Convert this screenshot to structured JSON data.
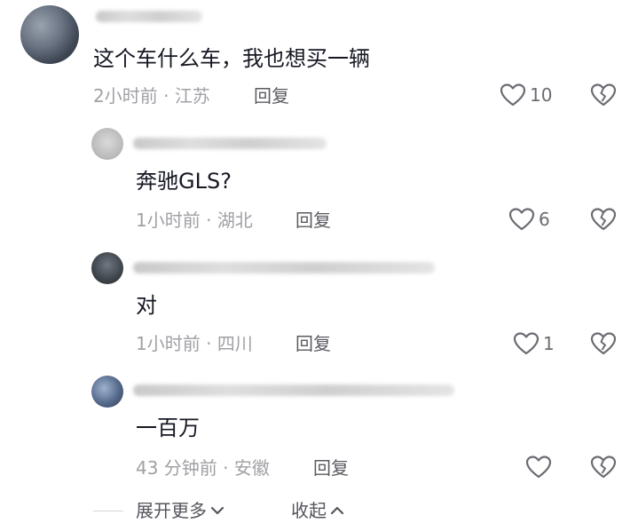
{
  "comments": [
    {
      "text": "这个车什么车，我也想买一辆",
      "time": "2小时前",
      "location": "江苏",
      "reply_label": "回复",
      "likes": "10"
    },
    {
      "text": "奔驰GLS?",
      "time": "1小时前",
      "location": "湖北",
      "reply_label": "回复",
      "likes": "6"
    },
    {
      "text": "对",
      "time": "1小时前",
      "location": "四川",
      "reply_label": "回复",
      "likes": "1"
    },
    {
      "text": "一百万",
      "time": "43 分钟前",
      "location": "安徽",
      "reply_label": "回复",
      "likes": ""
    }
  ],
  "meta_separator": " · ",
  "footer": {
    "expand_more": "展开更多",
    "collapse": "收起"
  },
  "colors": {
    "text": "#161823",
    "meta": "#a0a0a6",
    "icon": "#6b6b73"
  },
  "icons": [
    "heart-icon",
    "broken-heart-icon",
    "chevron-down-icon",
    "chevron-up-icon"
  ]
}
